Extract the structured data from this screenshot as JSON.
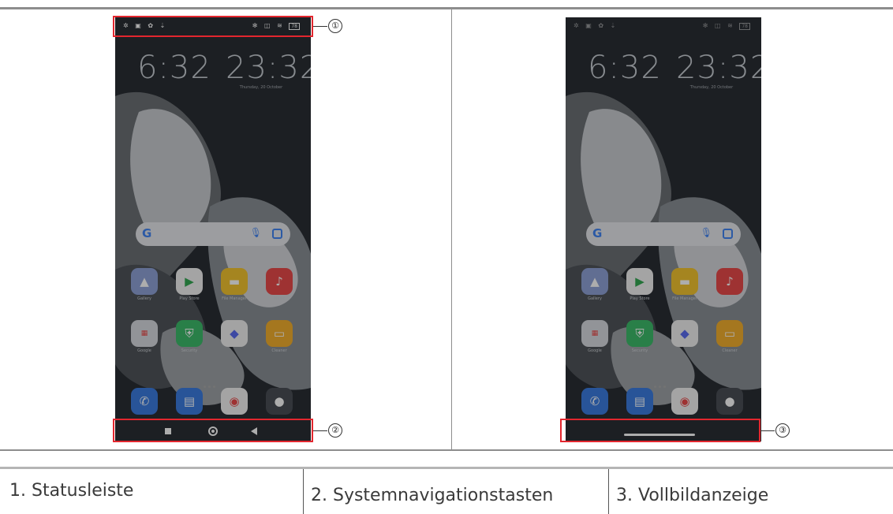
{
  "figure": {
    "left_phone": {
      "clocks": [
        {
          "time": "6:32"
        },
        {
          "time": "23:32",
          "date": "Thursday, 20 October"
        }
      ],
      "apps_row1": [
        "Gallery",
        "Play Store",
        "File Manager",
        "Music"
      ],
      "apps_row2": [
        "Google",
        "Security",
        "",
        "Cleaner"
      ],
      "callouts": [
        "①",
        "②"
      ]
    },
    "right_phone": {
      "clocks": [
        {
          "time": "6:32"
        },
        {
          "time": "23:32",
          "date": "Thursday, 20 October"
        }
      ],
      "apps_row1": [
        "Gallery",
        "Play Store",
        "File Manager",
        "Music"
      ],
      "apps_row2": [
        "Google",
        "Security",
        "",
        "Cleaner"
      ],
      "callouts": [
        "③"
      ]
    }
  },
  "legend": {
    "item1": "1. Statusleiste",
    "item2": "2. Systemnavigationstasten",
    "item3": "3. Vollbildanzeige"
  },
  "colors": {
    "callout_border": "#e3262e",
    "rule": "#8d8d8d"
  }
}
